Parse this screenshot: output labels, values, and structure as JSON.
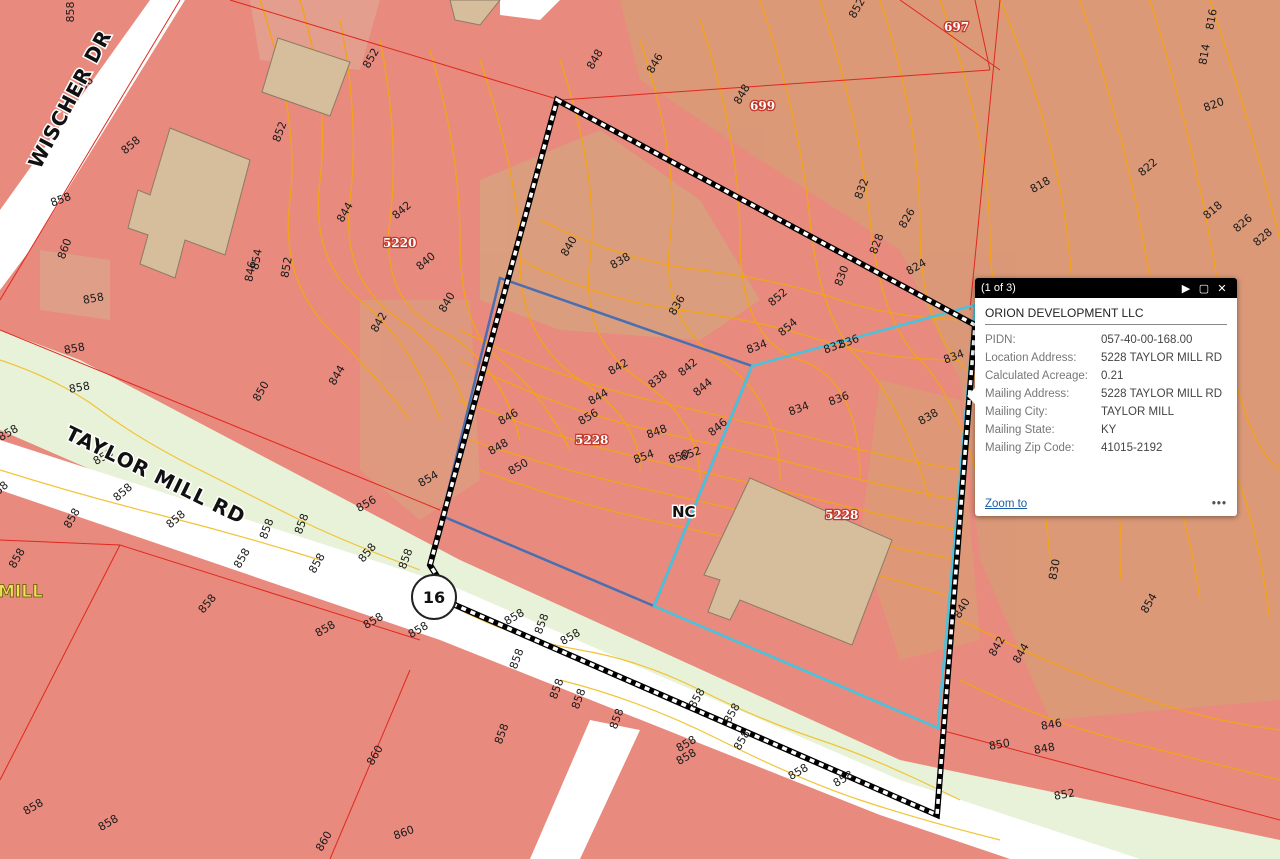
{
  "map": {
    "road_labels": {
      "wischer": "WISCHER DR",
      "taylor_mill": "TAYLOR MILL RD",
      "mill": "MILL"
    },
    "address_labels": [
      "697",
      "699",
      "5220",
      "5228",
      "5228"
    ],
    "zone_label": "NC",
    "route_shield": "16",
    "contour_labels": [
      "858",
      "860",
      "858",
      "858",
      "858",
      "858",
      "858",
      "858",
      "858",
      "858",
      "858",
      "858",
      "858",
      "858",
      "858",
      "858",
      "858",
      "858",
      "858",
      "858",
      "858",
      "858",
      "858",
      "858",
      "858",
      "858",
      "858",
      "858",
      "858",
      "858",
      "858",
      "858",
      "858",
      "858",
      "858",
      "858",
      "858",
      "858",
      "858",
      "858",
      "860",
      "860",
      "860",
      "858",
      "858",
      "852",
      "852",
      "850",
      "852",
      "848",
      "846",
      "848",
      "844",
      "842",
      "840",
      "840",
      "842",
      "844",
      "846",
      "852",
      "854",
      "856",
      "854",
      "848",
      "850",
      "852",
      "854",
      "846",
      "844",
      "842",
      "840",
      "838",
      "836",
      "834",
      "836",
      "834",
      "832",
      "830",
      "828",
      "826",
      "824",
      "822",
      "820",
      "818",
      "816",
      "814",
      "818",
      "826",
      "828",
      "830",
      "832",
      "834",
      "836",
      "838",
      "840",
      "842",
      "844",
      "846",
      "848",
      "850",
      "852",
      "854",
      "856",
      "838",
      "842",
      "844",
      "846",
      "848",
      "850",
      "852",
      "854",
      "838",
      "842"
    ]
  },
  "popup": {
    "count": "(1 of 3)",
    "title": "ORION DEVELOPMENT LLC",
    "fields": [
      {
        "label": "PIDN:",
        "value": "057-40-00-168.00"
      },
      {
        "label": "Location Address:",
        "value": "5228 TAYLOR MILL RD"
      },
      {
        "label": "Calculated Acreage:",
        "value": "0.21"
      },
      {
        "label": "Mailing Address:",
        "value": "5228 TAYLOR MILL RD"
      },
      {
        "label": "Mailing City:",
        "value": "TAYLOR MILL"
      },
      {
        "label": "Mailing State:",
        "value": "KY"
      },
      {
        "label": "Mailing Zip Code:",
        "value": "41015-2192"
      }
    ],
    "zoom_label": "Zoom to",
    "more_label": "•••",
    "next_icon": "play-icon",
    "maximize_icon": "maximize-icon",
    "close_icon": "close-icon"
  },
  "colors": {
    "zone_red": "#e88a7e",
    "terrain": "#d99a78",
    "road": "#ffffff",
    "contour": "#f3a21c",
    "parcel_line": "#e0281e",
    "selection_cyan": "#45c4e0",
    "selection_blue": "#4a6fb0",
    "building": "#d6bd9b"
  }
}
